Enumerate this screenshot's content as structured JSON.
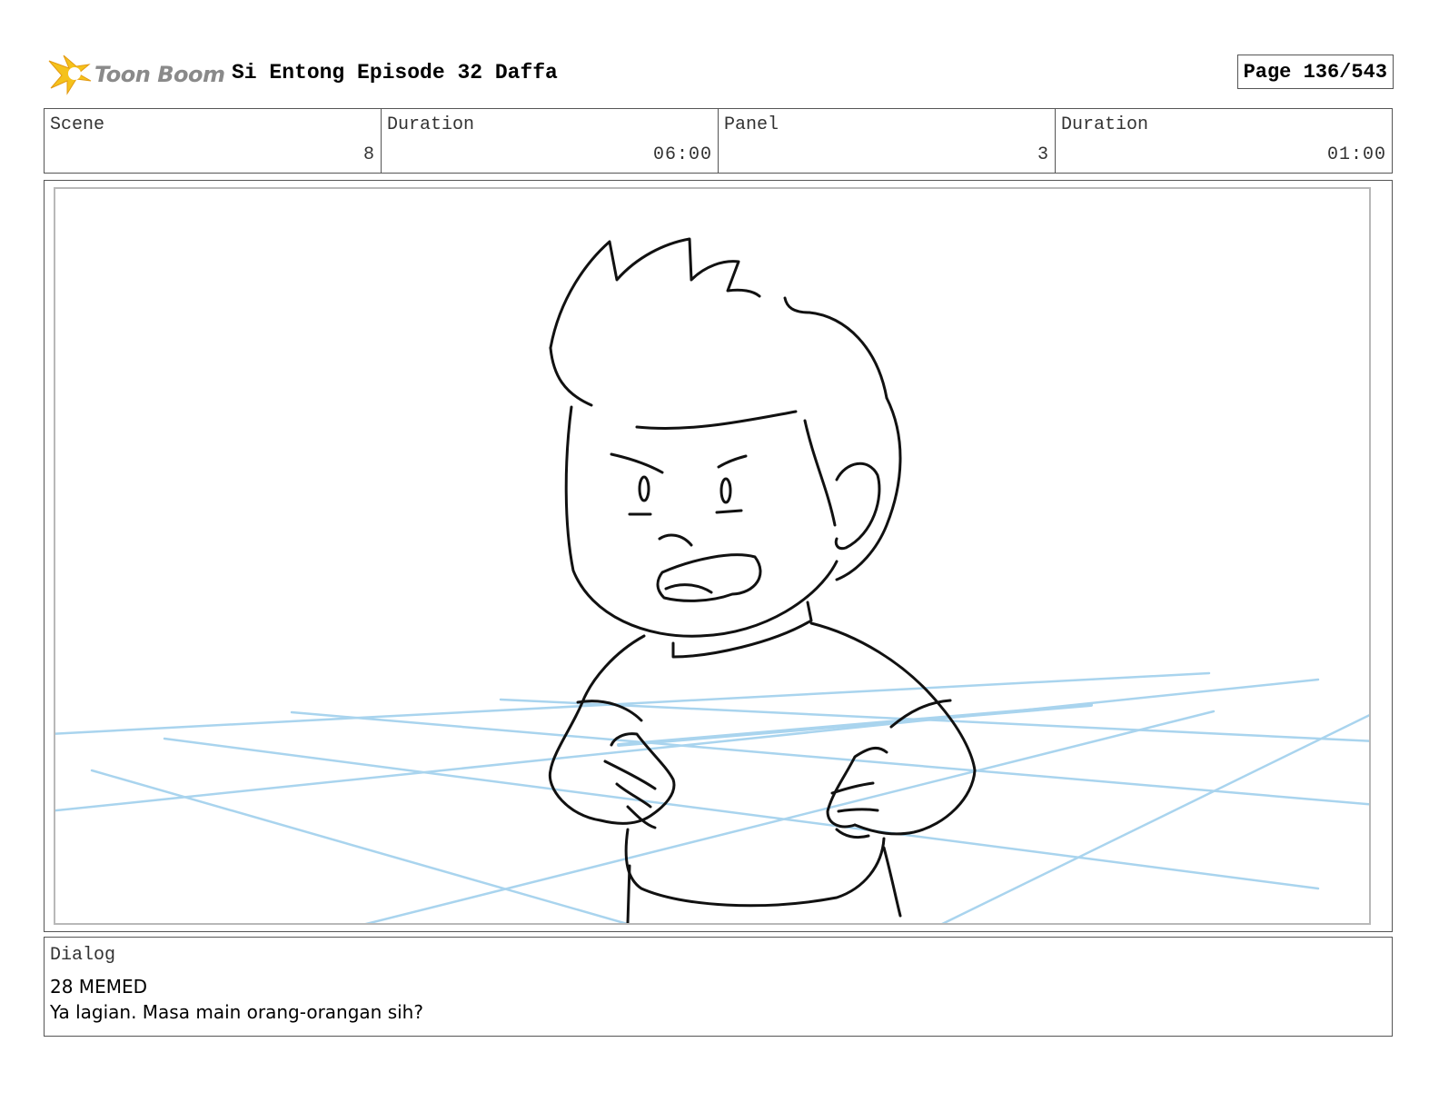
{
  "header": {
    "logo_text": "Toon Boom",
    "title": "Si Entong Episode 32 Daffa",
    "page": "Page 136/543"
  },
  "info": [
    {
      "label": "Scene",
      "value": "8"
    },
    {
      "label": "Duration",
      "value": "06:00"
    },
    {
      "label": "Panel",
      "value": "3"
    },
    {
      "label": "Duration",
      "value": "01:00"
    }
  ],
  "panel": {
    "image": "sketch-boy-angry",
    "line_color": "#111111",
    "floor_color": "#a9d4ee"
  },
  "dialog": {
    "label": "Dialog",
    "lines": [
      "28 MEMED",
      "Ya lagian. Masa main orang-orangan sih?"
    ]
  },
  "colors": {
    "logo_accent": "#f5c21b",
    "logo_text": "#8a8a8a",
    "border": "#555555"
  }
}
